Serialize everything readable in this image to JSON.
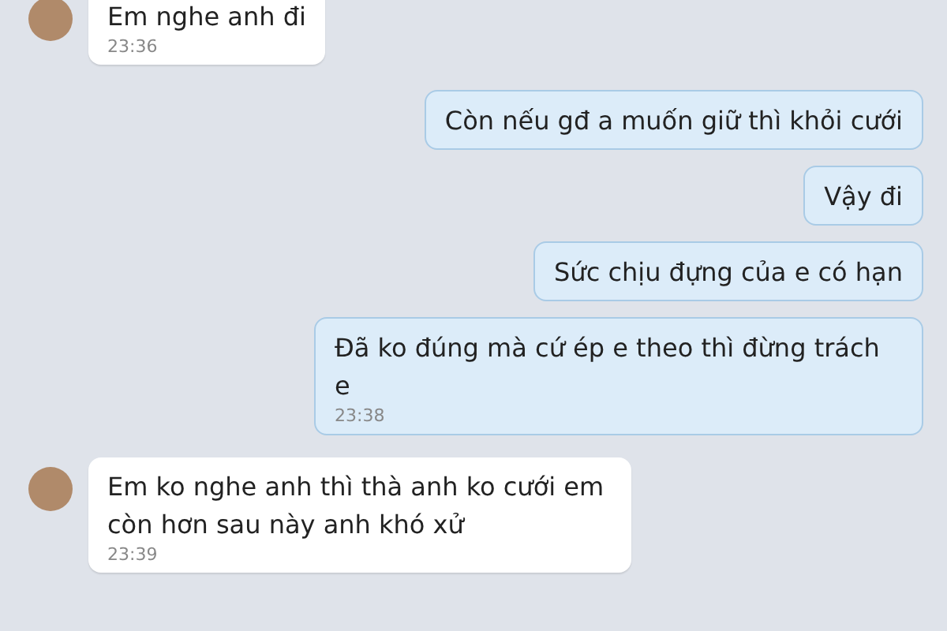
{
  "messages": [
    {
      "kind": "incoming",
      "text": "Em nghe anh đi",
      "time": "23:36"
    },
    {
      "kind": "outgoing",
      "text": "Còn nếu gđ a muốn giữ thì khỏi cưới"
    },
    {
      "kind": "outgoing",
      "text": "Vậy đi"
    },
    {
      "kind": "outgoing",
      "text": "Sức chịu đựng của e có hạn"
    },
    {
      "kind": "outgoing",
      "text": "Đã ko đúng mà cứ ép e theo thì đừng trách e",
      "time": "23:38"
    },
    {
      "kind": "incoming",
      "text": "Em ko nghe anh thì thà anh ko cưới em còn hơn sau này anh khó xử",
      "time": "23:39"
    }
  ]
}
